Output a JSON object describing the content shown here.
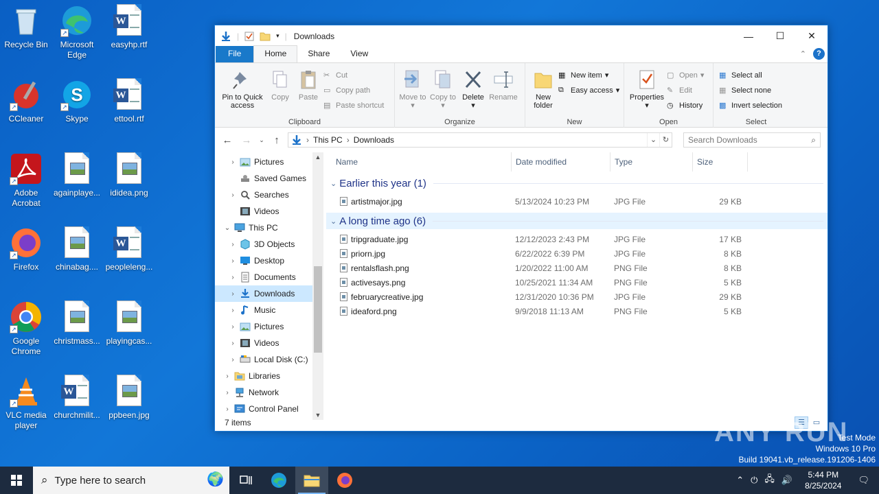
{
  "desktop": {
    "icons": [
      {
        "label": "Recycle Bin",
        "icon": "recycle-bin-icon"
      },
      {
        "label": "Microsoft Edge",
        "icon": "edge-icon"
      },
      {
        "label": "easyhp.rtf",
        "icon": "word-doc-icon"
      },
      {
        "label": "CCleaner",
        "icon": "ccleaner-icon"
      },
      {
        "label": "Skype",
        "icon": "skype-icon"
      },
      {
        "label": "ettool.rtf",
        "icon": "word-doc-icon"
      },
      {
        "label": "Adobe Acrobat",
        "icon": "acrobat-icon"
      },
      {
        "label": "againplaye...",
        "icon": "image-file-icon"
      },
      {
        "label": "ididea.png",
        "icon": "image-file-icon"
      },
      {
        "label": "Firefox",
        "icon": "firefox-icon"
      },
      {
        "label": "chinabag....",
        "icon": "image-file-icon"
      },
      {
        "label": "peopleleng...",
        "icon": "word-doc-icon"
      },
      {
        "label": "Google Chrome",
        "icon": "chrome-icon"
      },
      {
        "label": "christmass...",
        "icon": "image-file-icon"
      },
      {
        "label": "playingcas...",
        "icon": "image-file-icon"
      },
      {
        "label": "VLC media player",
        "icon": "vlc-icon"
      },
      {
        "label": "churchmilit...",
        "icon": "word-doc-icon"
      },
      {
        "label": "ppbeen.jpg",
        "icon": "image-file-icon"
      }
    ]
  },
  "window": {
    "title": "Downloads",
    "controls": {
      "minimize": "—",
      "maximize": "☐",
      "close": "✕"
    },
    "tabs": {
      "file": "File",
      "home": "Home",
      "share": "Share",
      "view": "View"
    },
    "help": "?",
    "ribbon": {
      "clipboard": {
        "group": "Clipboard",
        "pin": "Pin to Quick access",
        "copy": "Copy",
        "paste": "Paste",
        "cut": "Cut",
        "copy_path": "Copy path",
        "paste_shortcut": "Paste shortcut"
      },
      "organize": {
        "group": "Organize",
        "move_to": "Move to",
        "copy_to": "Copy to",
        "delete": "Delete",
        "rename": "Rename"
      },
      "new": {
        "group": "New",
        "new_folder": "New folder",
        "new_item": "New item",
        "easy_access": "Easy access"
      },
      "open": {
        "group": "Open",
        "properties": "Properties",
        "open": "Open",
        "edit": "Edit",
        "history": "History"
      },
      "select": {
        "group": "Select",
        "select_all": "Select all",
        "select_none": "Select none",
        "invert": "Invert selection"
      }
    },
    "address": {
      "crumbs": [
        "This PC",
        "Downloads"
      ],
      "search_placeholder": "Search Downloads"
    },
    "nav": [
      {
        "label": "Pictures",
        "indent": 1,
        "chev": "›",
        "icon": "pictures-folder-icon"
      },
      {
        "label": "Saved Games",
        "indent": 1,
        "chev": "",
        "icon": "saved-games-icon"
      },
      {
        "label": "Searches",
        "indent": 1,
        "chev": "›",
        "icon": "searches-icon"
      },
      {
        "label": "Videos",
        "indent": 1,
        "chev": "",
        "icon": "videos-folder-icon"
      },
      {
        "label": "This PC",
        "indent": 0,
        "chev": "⌄",
        "icon": "this-pc-icon"
      },
      {
        "label": "3D Objects",
        "indent": 1,
        "chev": "›",
        "icon": "3d-objects-icon"
      },
      {
        "label": "Desktop",
        "indent": 1,
        "chev": "›",
        "icon": "desktop-folder-icon"
      },
      {
        "label": "Documents",
        "indent": 1,
        "chev": "›",
        "icon": "documents-folder-icon"
      },
      {
        "label": "Downloads",
        "indent": 1,
        "chev": "›",
        "icon": "downloads-folder-icon",
        "selected": true
      },
      {
        "label": "Music",
        "indent": 1,
        "chev": "›",
        "icon": "music-folder-icon"
      },
      {
        "label": "Pictures",
        "indent": 1,
        "chev": "›",
        "icon": "pictures-folder-icon"
      },
      {
        "label": "Videos",
        "indent": 1,
        "chev": "›",
        "icon": "videos-folder-icon"
      },
      {
        "label": "Local Disk (C:)",
        "indent": 1,
        "chev": "›",
        "icon": "local-disk-icon"
      },
      {
        "label": "Libraries",
        "indent": 0,
        "chev": "›",
        "icon": "libraries-icon"
      },
      {
        "label": "Network",
        "indent": 0,
        "chev": "›",
        "icon": "network-icon"
      },
      {
        "label": "Control Panel",
        "indent": 0,
        "chev": "›",
        "icon": "control-panel-icon"
      }
    ],
    "columns": {
      "name": "Name",
      "date": "Date modified",
      "type": "Type",
      "size": "Size"
    },
    "groups": [
      {
        "label": "Earlier this year (1)",
        "files": [
          {
            "name": "artistmajor.jpg",
            "date": "5/13/2024 10:23 PM",
            "type": "JPG File",
            "size": "29 KB"
          }
        ]
      },
      {
        "label": "A long time ago (6)",
        "files": [
          {
            "name": "tripgraduate.jpg",
            "date": "12/12/2023 2:43 PM",
            "type": "JPG File",
            "size": "17 KB"
          },
          {
            "name": "priorn.jpg",
            "date": "6/22/2022 6:39 PM",
            "type": "JPG File",
            "size": "8 KB"
          },
          {
            "name": "rentalsflash.png",
            "date": "1/20/2022 11:00 AM",
            "type": "PNG File",
            "size": "8 KB"
          },
          {
            "name": "activesays.png",
            "date": "10/25/2021 11:34 AM",
            "type": "PNG File",
            "size": "5 KB"
          },
          {
            "name": "februarycreative.jpg",
            "date": "12/31/2020 10:36 PM",
            "type": "JPG File",
            "size": "29 KB"
          },
          {
            "name": "ideaford.png",
            "date": "9/9/2018 11:13 AM",
            "type": "PNG File",
            "size": "5 KB"
          }
        ]
      }
    ],
    "status": "7 items"
  },
  "watermark": "ANY RUN",
  "sysinfo": {
    "line1": "Test Mode",
    "line2": "Windows 10 Pro",
    "line3": "Build 19041.vb_release.191206-1406"
  },
  "taskbar": {
    "search_placeholder": "Type here to search",
    "time": "5:44 PM",
    "date": "8/25/2024"
  }
}
